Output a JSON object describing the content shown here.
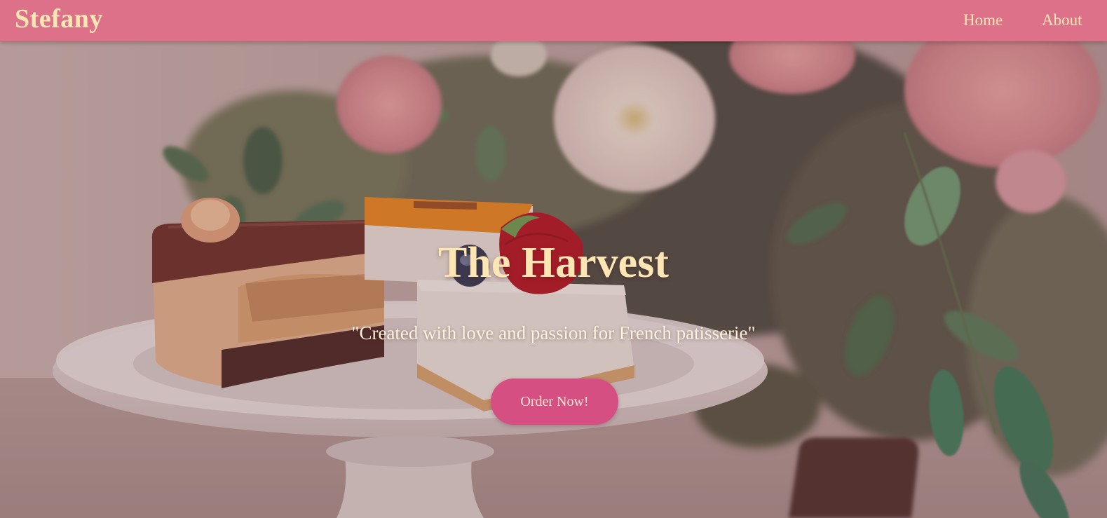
{
  "header": {
    "brand": "Stefany",
    "nav": {
      "home_label": "Home",
      "about_label": "About"
    }
  },
  "hero": {
    "title": "The Harvest",
    "tagline": "\"Created with love and passion for French patisserie\"",
    "cta_label": "Order Now!",
    "background_subject": "cake-slices-and-flowers-photo"
  },
  "colors": {
    "navbar_bg": "#dc7189",
    "brand_text": "#fbe6b4",
    "title_text": "#fbe6b4",
    "cta_bg": "#d54f82",
    "cta_text": "#fbe6d0"
  }
}
